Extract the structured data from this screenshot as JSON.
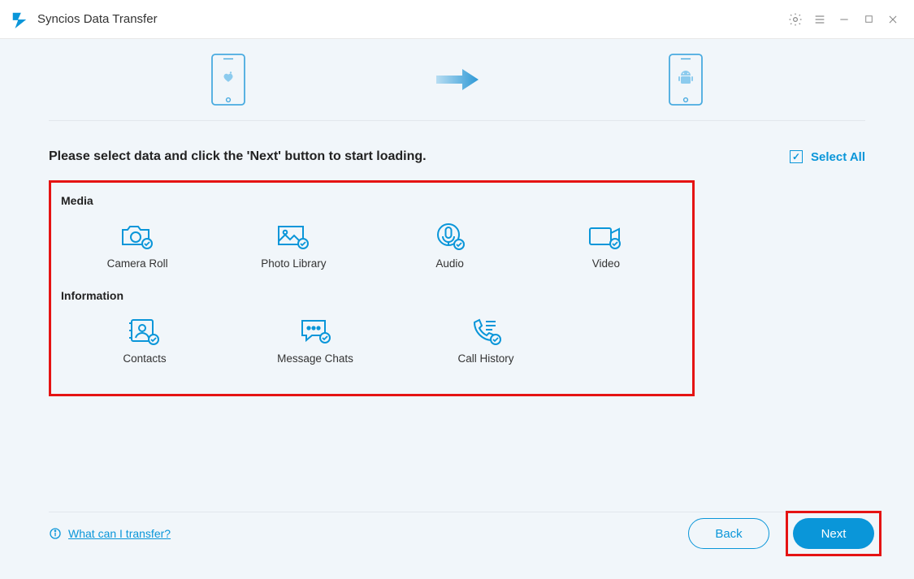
{
  "app": {
    "title": "Syncios Data Transfer"
  },
  "window": {
    "icons": {
      "settings": "gear-icon",
      "menu": "menu-icon",
      "minimize": "minimize-icon",
      "maximize": "maximize-icon",
      "close": "close-icon"
    }
  },
  "devices": {
    "source": "apple-phone",
    "target": "android-phone"
  },
  "instruction": "Please select data and click the 'Next' button to start loading.",
  "select_all": {
    "label": "Select All",
    "checked": true
  },
  "sections": [
    {
      "title": "Media",
      "items": [
        {
          "label": "Camera Roll",
          "icon": "camera-icon",
          "selected": true
        },
        {
          "label": "Photo Library",
          "icon": "photo-icon",
          "selected": true
        },
        {
          "label": "Audio",
          "icon": "audio-icon",
          "selected": true
        },
        {
          "label": "Video",
          "icon": "video-icon",
          "selected": true
        }
      ]
    },
    {
      "title": "Information",
      "items": [
        {
          "label": "Contacts",
          "icon": "contacts-icon",
          "selected": true
        },
        {
          "label": "Message Chats",
          "icon": "messages-icon",
          "selected": true
        },
        {
          "label": "Call History",
          "icon": "callhistory-icon",
          "selected": true
        }
      ]
    }
  ],
  "footer": {
    "help_link": "What can I transfer?",
    "back": "Back",
    "next": "Next"
  },
  "colors": {
    "accent": "#0a96d9",
    "annotation": "#e51313",
    "panel_bg": "#f1f6fa"
  }
}
